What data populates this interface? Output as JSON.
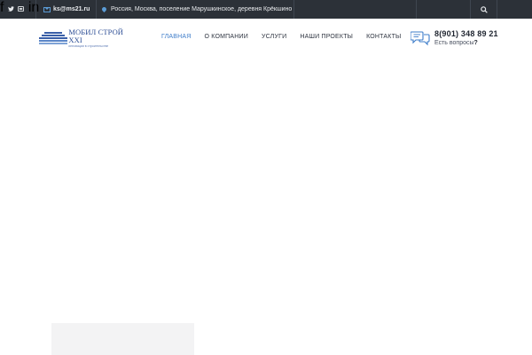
{
  "topbar": {
    "email": "ks@ms21.ru",
    "address": "Россия, Москва, поселение Марушкинское, деревня Крёкшино",
    "social": [
      "f",
      "t",
      "vk",
      "in"
    ]
  },
  "logo": {
    "title": "МОБИЛ СТРОЙ XXI",
    "subtitle": "инновации в строительстве"
  },
  "nav": {
    "items": [
      "ГЛАВНАЯ",
      "О КОМПАНИИ",
      "УСЛУГИ",
      "НАШИ ПРОЕКТЫ",
      "КОНТАКТЫ"
    ],
    "active_index": 0
  },
  "contact": {
    "phone": "8(901) 348 89 21",
    "question": "Есть вопросы",
    "question_mark": "?"
  },
  "colors": {
    "topbar_bg": "#2c3138",
    "accent": "#3d7cc9",
    "brand": "#2e4f96"
  },
  "icons": {
    "email": "envelope-icon",
    "address": "map-pin-icon",
    "search": "search-icon",
    "chat": "chat-bubbles-icon"
  }
}
